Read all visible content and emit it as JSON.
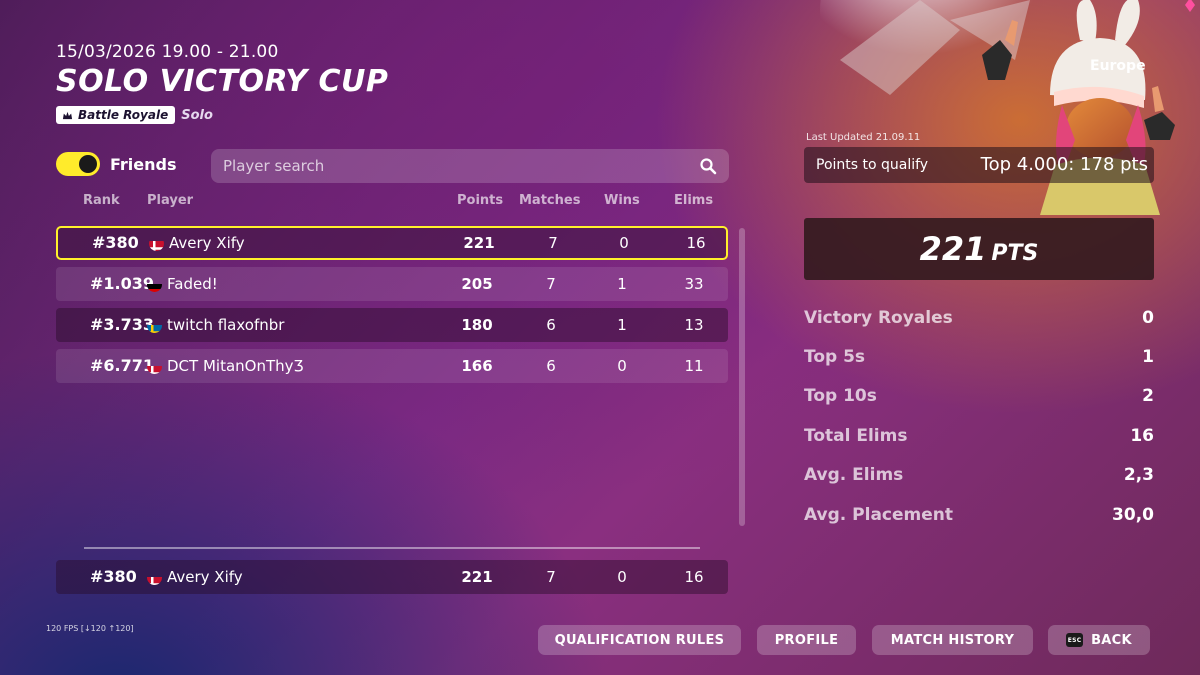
{
  "header": {
    "datetime": "15/03/2026 19.00 - 21.00",
    "title": "SOLO VICTORY CUP",
    "mode": "Battle Royale",
    "mode_icon": "crown-icon",
    "submode": "Solo"
  },
  "filters": {
    "friends_label": "Friends",
    "friends_on": true,
    "search_placeholder": "Player search",
    "search_icon": "search-icon"
  },
  "table": {
    "columns": [
      "Rank",
      "Player",
      "Points",
      "Matches",
      "Wins",
      "Elims"
    ],
    "rows": [
      {
        "rank": "#380",
        "flag": "denmark",
        "player": "Avery Xify",
        "points": "221",
        "matches": "7",
        "wins": "0",
        "elims": "16"
      },
      {
        "rank": "#1.039",
        "flag": "germany",
        "player": "Faded!",
        "points": "205",
        "matches": "7",
        "wins": "1",
        "elims": "33"
      },
      {
        "rank": "#3.733",
        "flag": "sweden",
        "player": "twitch flaxofnbr",
        "points": "180",
        "matches": "6",
        "wins": "1",
        "elims": "13"
      },
      {
        "rank": "#6.771",
        "flag": "denmark",
        "player": "DCT MitanOnThyƷ",
        "points": "166",
        "matches": "6",
        "wins": "0",
        "elims": "11"
      }
    ],
    "self": {
      "rank": "#380",
      "flag": "denmark",
      "player": "Avery Xify",
      "points": "221",
      "matches": "7",
      "wins": "0",
      "elims": "16"
    }
  },
  "panel": {
    "region": "Europe",
    "last_updated": "Last Updated 21.09.11",
    "qualify_label": "Points to qualify",
    "qualify_value": "Top 4.000: 178 pts",
    "points": "221",
    "points_unit": "PTS",
    "stats": [
      {
        "label": "Victory Royales",
        "value": "0"
      },
      {
        "label": "Top 5s",
        "value": "1"
      },
      {
        "label": "Top 10s",
        "value": "2"
      },
      {
        "label": "Total Elims",
        "value": "16"
      },
      {
        "label": "Avg. Elims",
        "value": "2,3"
      },
      {
        "label": "Avg. Placement",
        "value": "30,0"
      }
    ]
  },
  "footer": {
    "fps": "120 FPS [↓120 ↑120]",
    "buttons": {
      "qualification_rules": "QUALIFICATION RULES",
      "profile": "PROFILE",
      "match_history": "MATCH HISTORY",
      "back": "BACK"
    },
    "esc_key": "ESC"
  },
  "colors": {
    "highlight": "#fff12b",
    "toggle_on": "#ffeb2b",
    "bg_purple": "#7a2a83",
    "bg_orange": "#d67828"
  }
}
